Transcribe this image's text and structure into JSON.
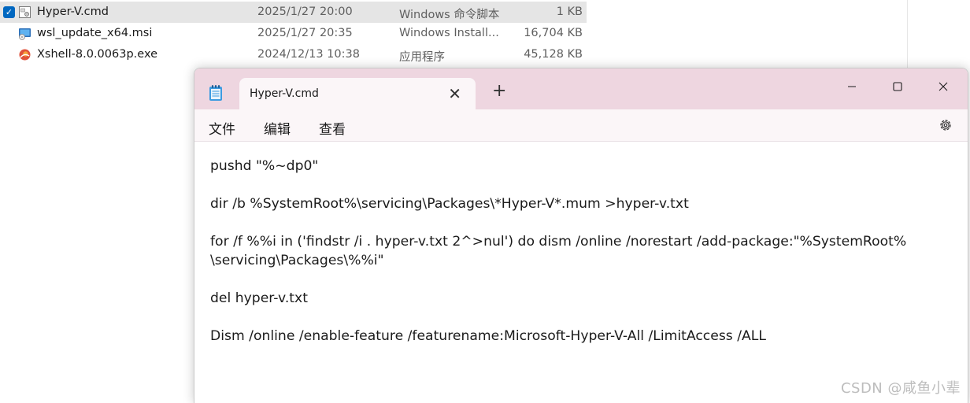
{
  "files": [
    {
      "name": "Hyper-V.cmd",
      "date": "2025/1/27 20:00",
      "type": "Windows 命令脚本",
      "size": "1 KB",
      "selected": true,
      "icon": "cmd-file-icon"
    },
    {
      "name": "wsl_update_x64.msi",
      "date": "2025/1/27 20:35",
      "type": "Windows Install...",
      "size": "16,704 KB",
      "selected": false,
      "icon": "msi-installer-icon"
    },
    {
      "name": "Xshell-8.0.0063p.exe",
      "date": "2024/12/13 10:38",
      "type": "应用程序",
      "size": "45,128 KB",
      "selected": false,
      "icon": "xshell-app-icon"
    }
  ],
  "notepad": {
    "tab_title": "Hyper-V.cmd",
    "new_tab_label": "+",
    "menu": {
      "file": "文件",
      "edit": "编辑",
      "view": "查看"
    },
    "lines": [
      "pushd \"%~dp0\"",
      "dir /b %SystemRoot%\\servicing\\Packages\\*Hyper-V*.mum >hyper-v.txt",
      "for /f %%i in ('findstr /i . hyper-v.txt 2^>nul') do dism /online /norestart /add-package:\"%SystemRoot%",
      "\\servicing\\Packages\\%%i\"",
      "del hyper-v.txt",
      "Dism /online /enable-feature /featurename:Microsoft-Hyper-V-All /LimitAccess /ALL"
    ]
  },
  "watermark": "CSDN @咸鱼小辈",
  "colors": {
    "titlebar": "#eed6e0",
    "selection": "#e5e5e5",
    "checkbox": "#0067c0"
  }
}
